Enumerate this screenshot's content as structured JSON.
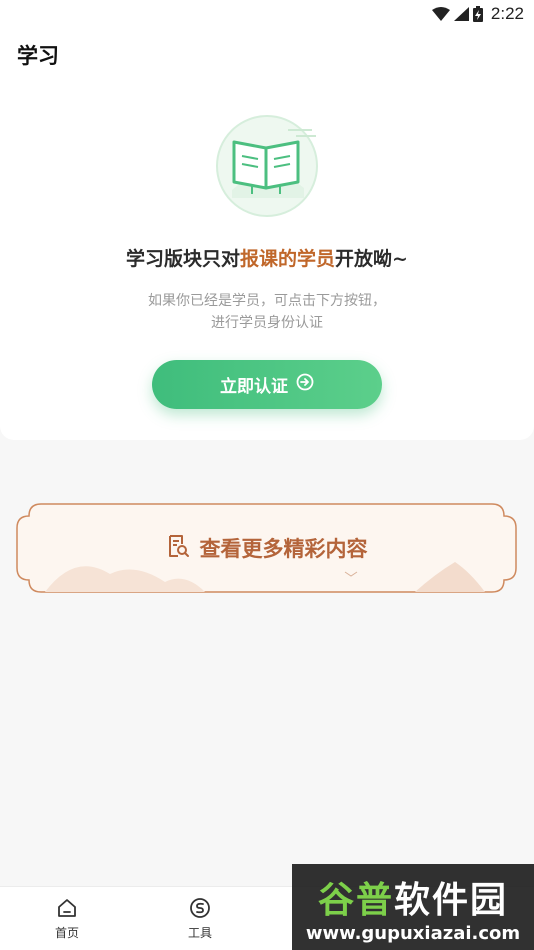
{
  "status_bar": {
    "time": "2:22",
    "icons": [
      "wifi-icon",
      "cellular-signal-icon",
      "battery-charging-icon"
    ]
  },
  "header": {
    "title": "学习"
  },
  "empty_state": {
    "illustration": "open-book-icon",
    "headline_before": "学习版块只对",
    "headline_highlight": "报课的学员",
    "headline_after": "开放呦~",
    "description_line1": "如果你已经是学员，可点击下方按钮，",
    "description_line2": "进行学员身份认证",
    "verify_button_label": "立即认证",
    "verify_button_icon": "arrow-circle-right-icon"
  },
  "more_banner": {
    "label": "查看更多精彩内容",
    "icon": "document-search-icon"
  },
  "bottom_nav": {
    "items": [
      {
        "label": "首页",
        "icon": "home-icon"
      },
      {
        "label": "工具",
        "icon": "tools-icon"
      }
    ]
  },
  "watermark": {
    "title_part1": "谷普",
    "title_part2": "软件园",
    "url": "www.gupuxiazai.com"
  },
  "colors": {
    "accent_green": "#3fbd7c",
    "highlight_orange": "#c0672a",
    "banner_brown": "#b4643a"
  }
}
